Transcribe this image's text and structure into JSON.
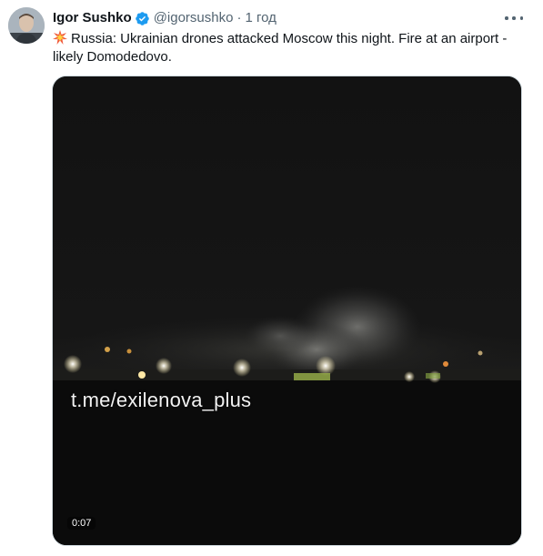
{
  "author": {
    "name": "Igor Sushko",
    "handle": "@igorsushko",
    "separator": "·",
    "time": "1 год",
    "verified": true
  },
  "tweet": {
    "emoji": "collision-emoji",
    "text": "Russia: Ukrainian drones attacked Moscow this night. Fire at an airport - likely Domodedovo."
  },
  "media": {
    "type": "video",
    "watermark": "t.me/exilenova_plus",
    "duration": "0:07"
  },
  "icons": {
    "verified": "verified-badge-icon",
    "more": "more-options-icon",
    "emoji": "collision-emoji"
  },
  "colors": {
    "accent": "#1d9bf0",
    "text": "#0f1419",
    "muted": "#536471",
    "border": "#cfd9de"
  }
}
